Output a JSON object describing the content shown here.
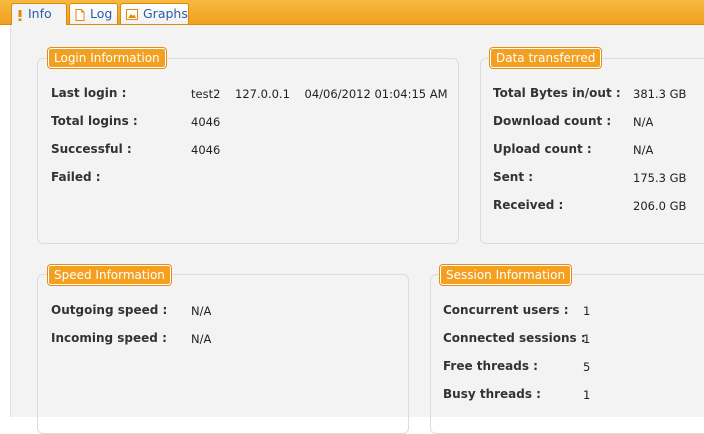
{
  "tabs": [
    {
      "label": "Info",
      "icon": "exclamation-icon"
    },
    {
      "label": "Log",
      "icon": "document-icon"
    },
    {
      "label": "Graphs",
      "icon": "image-icon"
    }
  ],
  "login": {
    "title": "Login Information",
    "rows": [
      {
        "label": "Last login :",
        "value": "test2    127.0.0.1    04/06/2012 01:04:15 AM"
      },
      {
        "label": "Total logins :",
        "value": "4046"
      },
      {
        "label": "Successful :",
        "value": "4046"
      },
      {
        "label": "Failed :",
        "value": ""
      }
    ]
  },
  "data": {
    "title": "Data transferred",
    "rows": [
      {
        "label": "Total Bytes in/out :",
        "value": "381.3 GB"
      },
      {
        "label": "Download count :",
        "value": "N/A"
      },
      {
        "label": "Upload count :",
        "value": "N/A"
      },
      {
        "label": "Sent :",
        "value": "175.3 GB"
      },
      {
        "label": "Received :",
        "value": "206.0 GB"
      }
    ]
  },
  "speed": {
    "title": "Speed Information",
    "rows": [
      {
        "label": "Outgoing speed :",
        "value": "N/A"
      },
      {
        "label": "Incoming speed :",
        "value": "N/A"
      }
    ]
  },
  "session": {
    "title": "Session Information",
    "rows": [
      {
        "label": "Concurrent users :",
        "value": "1"
      },
      {
        "label": "Connected sessions :",
        "value": "1"
      },
      {
        "label": "Free threads :",
        "value": "5"
      },
      {
        "label": "Busy threads :",
        "value": "1"
      }
    ]
  }
}
